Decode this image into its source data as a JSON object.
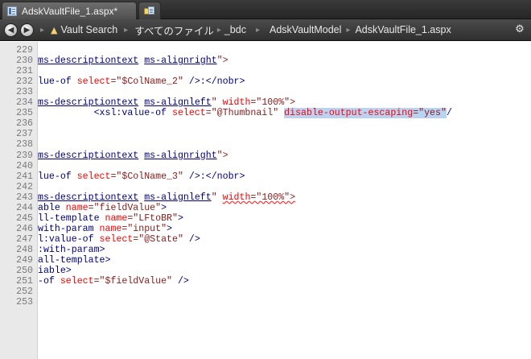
{
  "tabs": {
    "active_label": "AdskVaultFile_1.aspx*",
    "second_icon": "vault-explorer-icon"
  },
  "breadcrumb": {
    "back_icon": "back-arrow-icon",
    "forward_icon": "forward-arrow-icon",
    "items": [
      "Vault Search",
      "すべてのファイル",
      "_bdc",
      "AdskVaultModel",
      "AdskVaultFile_1.aspx"
    ],
    "settings_icon": "settings-icon"
  },
  "editor": {
    "lines": [
      {
        "num": "229",
        "segments": []
      },
      {
        "num": "230",
        "segments": [
          {
            "text": "ms-descriptiontext",
            "cls": "t-tag t-ul"
          },
          {
            "text": " ",
            "cls": "t-tag"
          },
          {
            "text": "ms-alignright",
            "cls": "t-tag t-ul"
          },
          {
            "text": "\">",
            "cls": "t-val"
          }
        ]
      },
      {
        "num": "231",
        "segments": []
      },
      {
        "num": "232",
        "segments": [
          {
            "text": "lue-of ",
            "cls": "t-tag"
          },
          {
            "text": "select",
            "cls": "t-attr"
          },
          {
            "text": "=\"$ColName_2\"",
            "cls": "t-val"
          },
          {
            "text": " />:</nobr>",
            "cls": "t-tag"
          }
        ]
      },
      {
        "num": "233",
        "segments": []
      },
      {
        "num": "234",
        "segments": [
          {
            "text": "ms-descriptiontext",
            "cls": "t-tag t-ul"
          },
          {
            "text": " ",
            "cls": "t-tag"
          },
          {
            "text": "ms-alignleft",
            "cls": "t-tag t-ul"
          },
          {
            "text": "\" ",
            "cls": "t-val"
          },
          {
            "text": "width",
            "cls": "t-attr"
          },
          {
            "text": "=\"100%\">",
            "cls": "t-val"
          }
        ]
      },
      {
        "num": "235",
        "segments": [
          {
            "text": "          <xsl:value-of ",
            "cls": "t-tag"
          },
          {
            "text": "select",
            "cls": "t-attr"
          },
          {
            "text": "=\"@Thumbnail\"",
            "cls": "t-val"
          },
          {
            "text": " ",
            "cls": "t-tag"
          },
          {
            "text": "disable-output-escaping",
            "cls": "t-attr t-sel"
          },
          {
            "text": "=\"yes\"",
            "cls": "t-val t-sel"
          },
          {
            "text": "/",
            "cls": "t-tag"
          }
        ]
      },
      {
        "num": "236",
        "segments": []
      },
      {
        "num": "237",
        "segments": []
      },
      {
        "num": "238",
        "segments": []
      },
      {
        "num": "239",
        "segments": [
          {
            "text": "ms-descriptiontext",
            "cls": "t-tag t-ul"
          },
          {
            "text": " ",
            "cls": "t-tag"
          },
          {
            "text": "ms-alignright",
            "cls": "t-tag t-ul"
          },
          {
            "text": "\">",
            "cls": "t-val"
          }
        ]
      },
      {
        "num": "240",
        "segments": []
      },
      {
        "num": "241",
        "segments": [
          {
            "text": "lue-of ",
            "cls": "t-tag"
          },
          {
            "text": "select",
            "cls": "t-attr"
          },
          {
            "text": "=\"$ColName_3\"",
            "cls": "t-val"
          },
          {
            "text": " />:</nobr>",
            "cls": "t-tag"
          }
        ]
      },
      {
        "num": "242",
        "segments": []
      },
      {
        "num": "243",
        "segments": [
          {
            "text": "ms-descriptiontext",
            "cls": "t-tag t-ul"
          },
          {
            "text": " ",
            "cls": "t-tag"
          },
          {
            "text": "ms-alignleft",
            "cls": "t-tag t-ul"
          },
          {
            "text": "\" ",
            "cls": "t-val"
          },
          {
            "text": "width",
            "cls": "t-attr t-wavy"
          },
          {
            "text": "=\"100%\">",
            "cls": "t-val t-wavy"
          }
        ]
      },
      {
        "num": "244",
        "segments": [
          {
            "text": "able ",
            "cls": "t-tag"
          },
          {
            "text": "name",
            "cls": "t-attr"
          },
          {
            "text": "=\"fieldValue\"",
            "cls": "t-val"
          },
          {
            "text": ">",
            "cls": "t-tag"
          }
        ]
      },
      {
        "num": "245",
        "segments": [
          {
            "text": "ll-template ",
            "cls": "t-tag"
          },
          {
            "text": "name",
            "cls": "t-attr"
          },
          {
            "text": "=\"LFtoBR\"",
            "cls": "t-val"
          },
          {
            "text": ">",
            "cls": "t-tag"
          }
        ]
      },
      {
        "num": "246",
        "segments": [
          {
            "text": "with-param ",
            "cls": "t-tag"
          },
          {
            "text": "name",
            "cls": "t-attr"
          },
          {
            "text": "=\"input\"",
            "cls": "t-val"
          },
          {
            "text": ">",
            "cls": "t-tag"
          }
        ]
      },
      {
        "num": "247",
        "segments": [
          {
            "text": "l:value-of ",
            "cls": "t-tag"
          },
          {
            "text": "select",
            "cls": "t-attr"
          },
          {
            "text": "=\"@State\"",
            "cls": "t-val"
          },
          {
            "text": " />",
            "cls": "t-tag"
          }
        ]
      },
      {
        "num": "248",
        "segments": [
          {
            "text": ":with-param>",
            "cls": "t-tag"
          }
        ]
      },
      {
        "num": "249",
        "segments": [
          {
            "text": "all-template>",
            "cls": "t-tag"
          }
        ]
      },
      {
        "num": "250",
        "segments": [
          {
            "text": "iable>",
            "cls": "t-tag"
          }
        ]
      },
      {
        "num": "251",
        "segments": [
          {
            "text": "-of ",
            "cls": "t-tag"
          },
          {
            "text": "select",
            "cls": "t-attr"
          },
          {
            "text": "=\"$fieldValue\"",
            "cls": "t-val"
          },
          {
            "text": " />",
            "cls": "t-tag"
          }
        ]
      },
      {
        "num": "252",
        "segments": []
      },
      {
        "num": "253",
        "segments": []
      }
    ]
  }
}
